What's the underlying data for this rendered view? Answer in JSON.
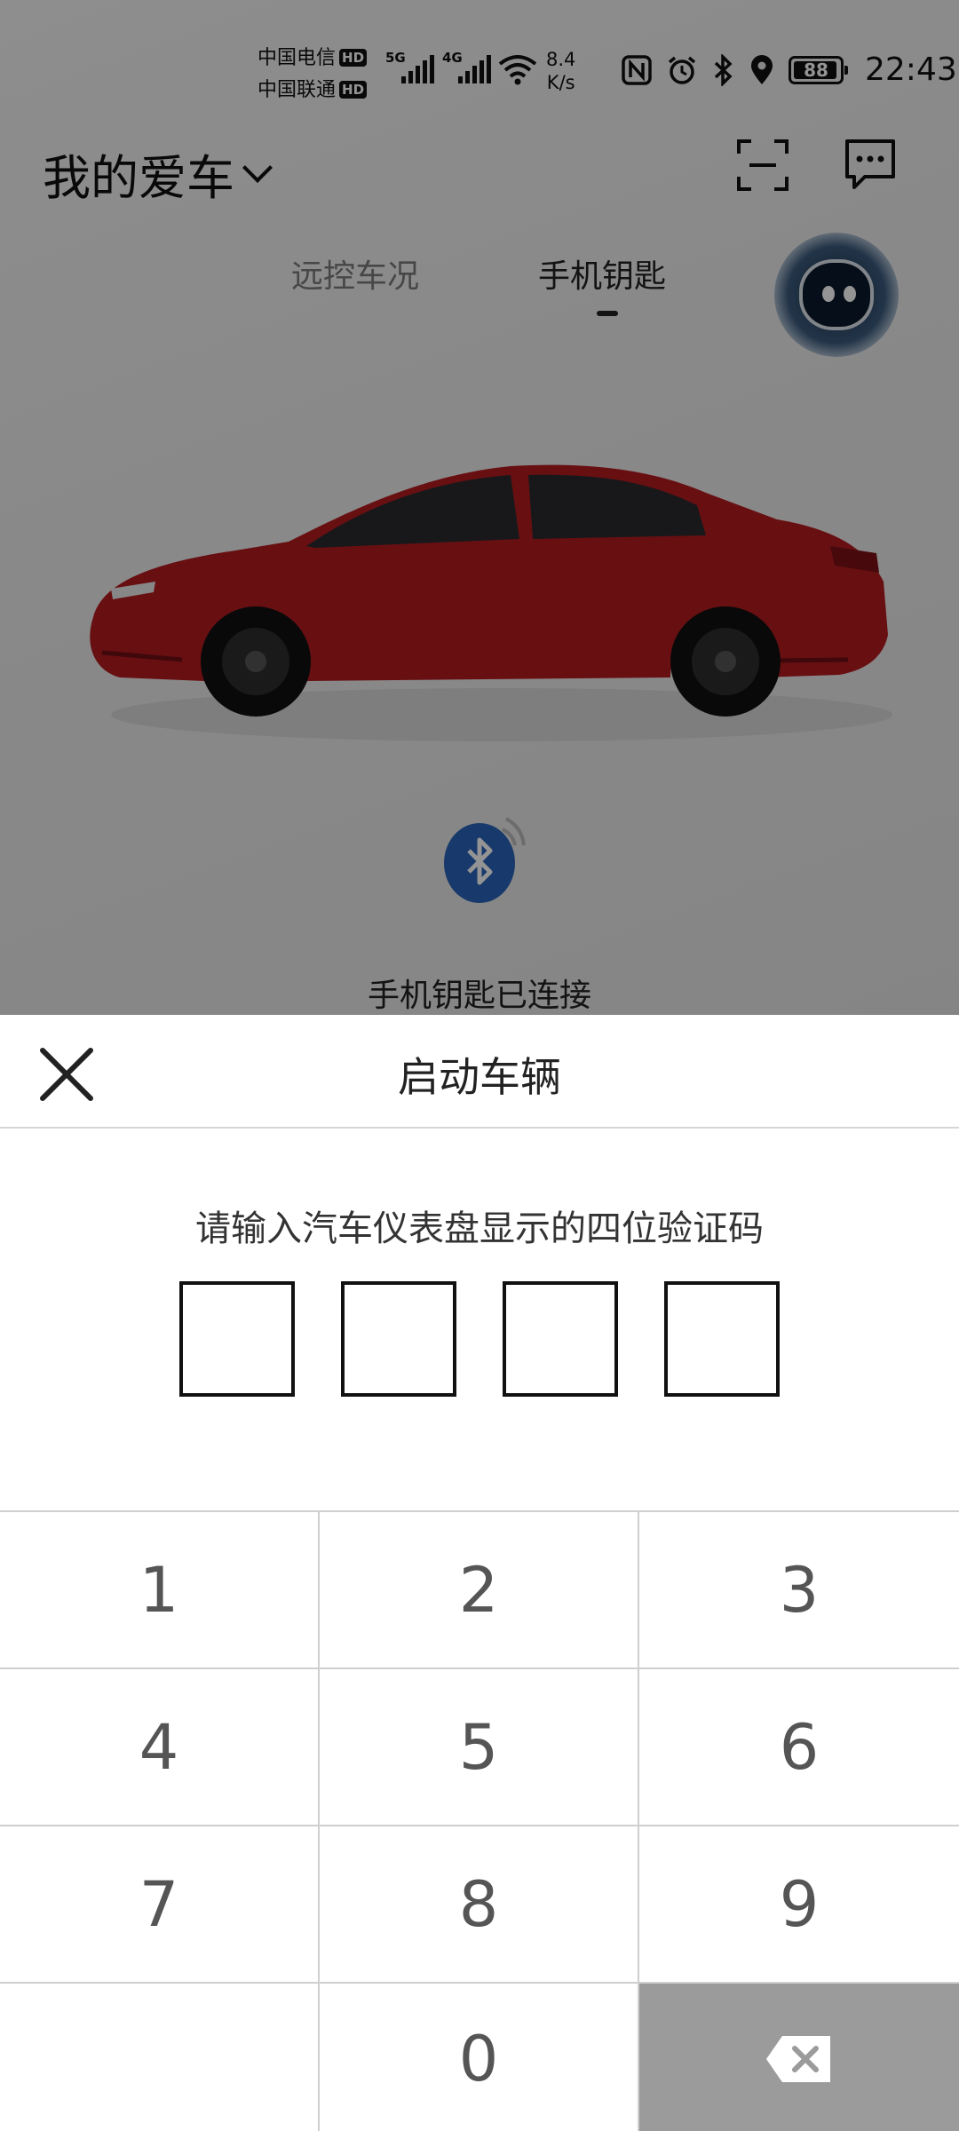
{
  "status_bar": {
    "carrier_1": "中国电信",
    "carrier_2": "中国联通",
    "hd_badge": "HD",
    "network_1": "5G",
    "network_2": "4G",
    "speed_value": "8.4",
    "speed_unit": "K/s",
    "battery": "88",
    "time": "22:43"
  },
  "header": {
    "title": "我的爱车"
  },
  "tabs": {
    "remote": "远控车况",
    "key": "手机钥匙",
    "active": "key"
  },
  "key_status": {
    "label": "手机钥匙已连接"
  },
  "dialog": {
    "title": "启动车辆",
    "prompt": "请输入汽车仪表盘显示的四位验证码",
    "code": [
      "",
      "",
      "",
      ""
    ]
  },
  "keypad": {
    "keys": [
      "1",
      "2",
      "3",
      "4",
      "5",
      "6",
      "7",
      "8",
      "9",
      "",
      "0"
    ]
  },
  "colors": {
    "car": "#b31b20",
    "bluetooth": "#2a63b8",
    "backspace_key": "#9b9b9b"
  }
}
